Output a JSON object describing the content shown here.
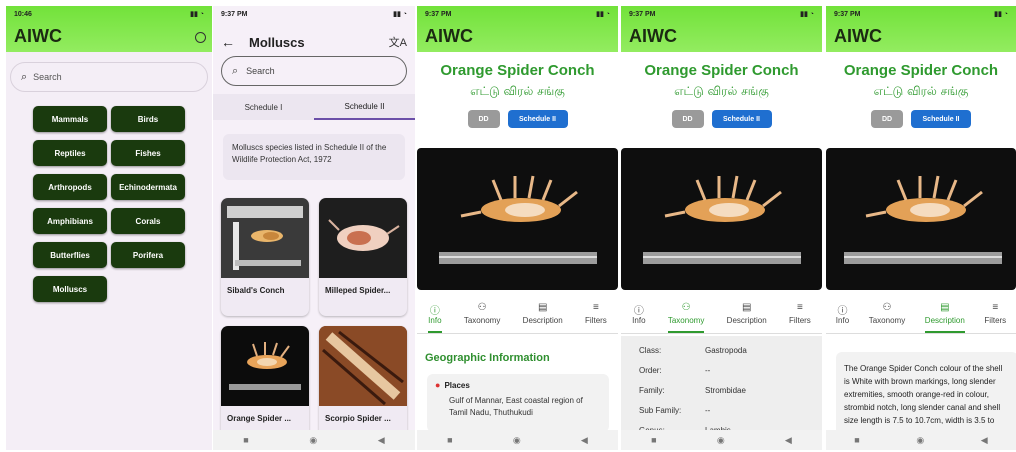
{
  "screen1": {
    "status_time": "10:46",
    "app_title": "AIWC",
    "search_placeholder": "Search",
    "categories": [
      "Mammals",
      "Birds",
      "Reptiles",
      "Fishes",
      "Arthropods",
      "Echinodermata",
      "Amphibians",
      "Corals",
      "Butterflies",
      "Porifera",
      "Molluscs"
    ]
  },
  "screen2": {
    "status_time": "9:37 PM",
    "title": "Molluscs",
    "search_placeholder": "Search",
    "tabs": [
      "Schedule I",
      "Schedule II"
    ],
    "info_text": "Molluscs species listed in Schedule II of the Wildlife Protection Act, 1972",
    "species": [
      "Sibald's Conch",
      "Milleped Spider...",
      "Orange Spider ...",
      "Scorpio Spider ..."
    ]
  },
  "detail": {
    "status_time": "9:37 PM",
    "app_title": "AIWC",
    "species_name": "Orange Spider Conch",
    "tamil_name": "எட்டு விரல் சங்கு",
    "badge_dd": "DD",
    "badge_schedule": "Schedule II",
    "tabs": [
      "Info",
      "Taxonomy",
      "Description",
      "Filters"
    ],
    "geo_heading": "Geographic Information",
    "places_label": "Places",
    "places_text": "Gulf of Mannar, East coastal region of Tamil Nadu, Thuthukudi",
    "taxonomy": [
      {
        "k": "Class:",
        "v": "Gastropoda"
      },
      {
        "k": "Order:",
        "v": "--"
      },
      {
        "k": "Family:",
        "v": "Strombidae"
      },
      {
        "k": "Sub Family:",
        "v": "--"
      },
      {
        "k": "Genus:",
        "v": "Lambis"
      }
    ],
    "description": "The Orange Spider Conch colour of the shell is White with brown markings, long slender extremities, smooth orange-red in colour, strombid notch, long slender canal and shell size length is 7.5 to 10.7cm, width is 3.5 to"
  },
  "colors": {
    "accent_green": "#2f9a2f",
    "appbar_green": "#7ce94a",
    "category_bg": "#1a3a0e",
    "schedule_blue": "#1f6fd0"
  }
}
